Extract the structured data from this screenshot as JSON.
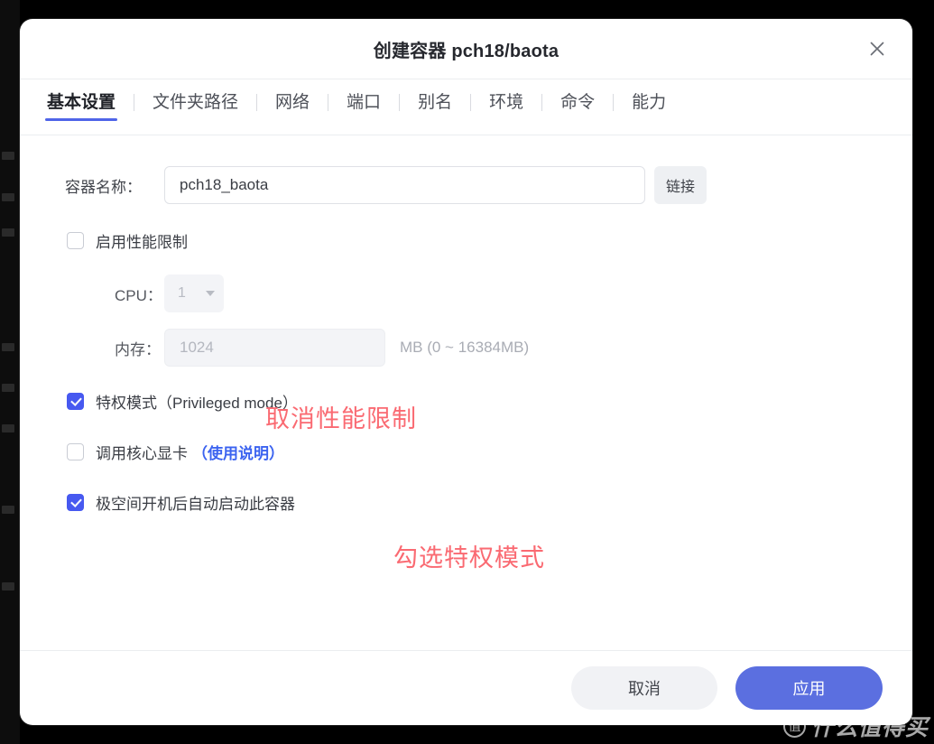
{
  "dialog": {
    "title": "创建容器 pch18/baota",
    "close_icon": "close-icon"
  },
  "tabs": [
    {
      "label": "基本设置",
      "active": true
    },
    {
      "label": "文件夹路径",
      "active": false
    },
    {
      "label": "网络",
      "active": false
    },
    {
      "label": "端口",
      "active": false
    },
    {
      "label": "别名",
      "active": false
    },
    {
      "label": "环境",
      "active": false
    },
    {
      "label": "命令",
      "active": false
    },
    {
      "label": "能力",
      "active": false
    }
  ],
  "form": {
    "container_name_label": "容器名称：",
    "container_name_value": "pch18_baota",
    "container_name_placeholder": "",
    "link_button_label": "链接",
    "enable_perf_limit_label": "启用性能限制",
    "enable_perf_limit_checked": false,
    "cpu_label": "CPU：",
    "cpu_value": "1",
    "memory_label": "内存：",
    "memory_value": "1024",
    "memory_hint": "MB (0 ~ 16384MB)",
    "privileged_label": "特权模式（Privileged mode）",
    "privileged_checked": true,
    "gpu_label": "调用核心显卡",
    "gpu_link_label": "（使用说明）",
    "gpu_checked": false,
    "autostart_label": "极空间开机后自动启动此容器",
    "autostart_checked": true
  },
  "annotations": {
    "cancel_perf_limit": "取消性能限制",
    "check_privileged": "勾选特权模式"
  },
  "footer": {
    "cancel_label": "取消",
    "apply_label": "应用"
  },
  "watermark": {
    "logo_char": "值",
    "text": "什么值得买"
  },
  "colors": {
    "accent_blue": "#4f64e8",
    "checkbox_blue": "#4759f0",
    "apply_button": "#5b6fe0",
    "link_blue": "#3b63f0",
    "annotation_red": "#fa6a72",
    "backdrop": "#000000"
  }
}
